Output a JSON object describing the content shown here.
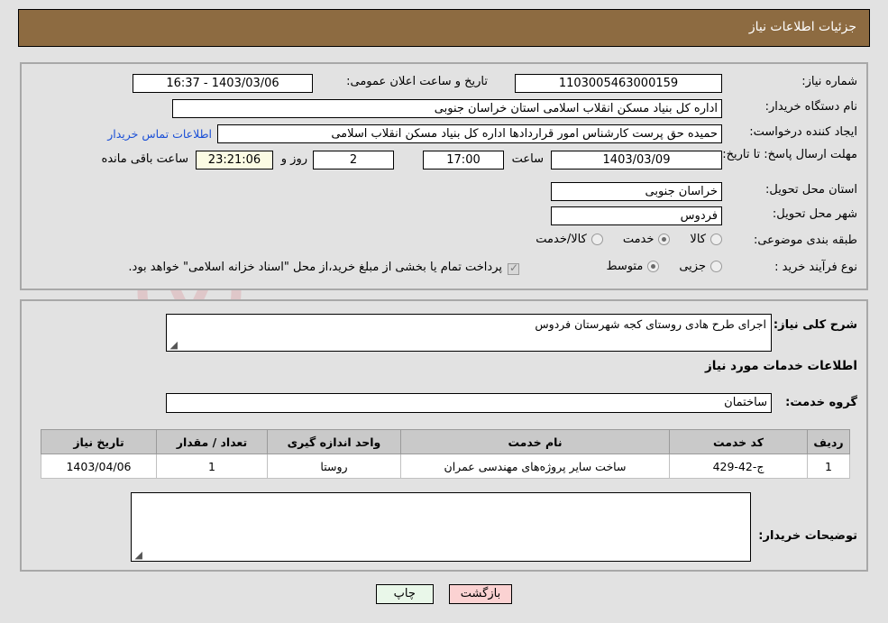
{
  "header": {
    "title": "جزئیات اطلاعات نیاز"
  },
  "watermark": {
    "text": "AriaTender.net"
  },
  "top_panel": {
    "need_number": {
      "label": "شماره نیاز:",
      "value": "1103005463000159"
    },
    "public_announce": {
      "label": "تاریخ و ساعت اعلان عمومی:",
      "value": "1403/03/06 - 16:37"
    },
    "buyer_org": {
      "label": "نام دستگاه خریدار:",
      "value": "اداره کل بنیاد مسکن انقلاب اسلامی استان خراسان جنوبی"
    },
    "request_creator": {
      "label": "ایجاد کننده درخواست:",
      "value": "حمیده حق پرست کارشناس امور قراردادها اداره کل بنیاد مسکن انقلاب اسلامی",
      "contact_link": "اطلاعات تماس خریدار"
    },
    "deadline": {
      "label": "مهلت ارسال پاسخ: تا تاریخ:",
      "date": "1403/03/09",
      "time_label": "ساعت",
      "time": "17:00",
      "days": "2",
      "days_label": "روز و",
      "countdown": "23:21:06",
      "remaining_label": "ساعت باقی مانده"
    },
    "delivery_province": {
      "label": "استان محل تحویل:",
      "value": "خراسان جنوبی"
    },
    "delivery_city": {
      "label": "شهر محل تحویل:",
      "value": "فردوس"
    },
    "subject_category": {
      "label": "طبقه بندی موضوعی:",
      "options": [
        {
          "label": "کالا",
          "selected": false
        },
        {
          "label": "خدمت",
          "selected": true
        },
        {
          "label": "کالا/خدمت",
          "selected": false
        }
      ]
    },
    "purchase_process": {
      "label": "نوع فرآیند خرید :",
      "options": [
        {
          "label": "جزیی",
          "selected": false
        },
        {
          "label": "متوسط",
          "selected": true
        }
      ],
      "treasury_checkbox_checked": true,
      "treasury_note": "پرداخت تمام یا بخشی از مبلغ خرید،از محل \"اسناد خزانه اسلامی\" خواهد بود."
    }
  },
  "bottom_panel": {
    "general_description": {
      "label": "شرح کلی نیاز:",
      "value": "اجرای طرح هادی روستای کجه شهرستان فردوس"
    },
    "services_section_title": "اطلاعات خدمات مورد نیاز",
    "service_group": {
      "label": "گروه خدمت:",
      "value": "ساختمان"
    },
    "table": {
      "headers": [
        "ردیف",
        "کد خدمت",
        "نام خدمت",
        "واحد اندازه گیری",
        "تعداد / مقدار",
        "تاریخ نیاز"
      ],
      "rows": [
        [
          "1",
          "ج-42-429",
          "ساخت سایر پروژه‌های مهندسی عمران",
          "روستا",
          "1",
          "1403/04/06"
        ]
      ]
    },
    "buyer_comments": {
      "label": "توضیحات خریدار:",
      "value": ""
    }
  },
  "buttons": {
    "print": "چاپ",
    "back": "بازگشت"
  }
}
